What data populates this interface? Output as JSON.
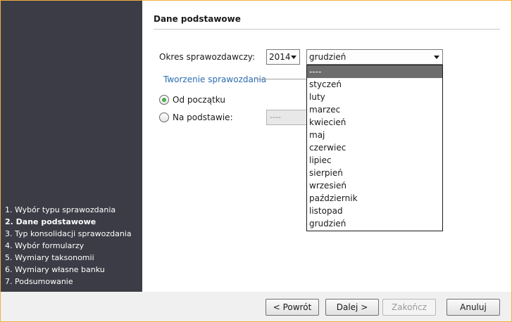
{
  "sidebar": {
    "steps": [
      {
        "label": "1. Wybór typu sprawozdania",
        "active": false
      },
      {
        "label": "2. Dane podstawowe",
        "active": true
      },
      {
        "label": "3. Typ konsolidacji sprawozdania",
        "active": false
      },
      {
        "label": "4. Wybór formularzy",
        "active": false
      },
      {
        "label": "5. Wymiary taksonomii",
        "active": false
      },
      {
        "label": "6. Wymiary własne banku",
        "active": false
      },
      {
        "label": "7. Podsumowanie",
        "active": false
      }
    ]
  },
  "main": {
    "section_title": "Dane podstawowe",
    "okres_label": "Okres sprawozdawczy:",
    "year_value": "2014",
    "month_value": "grudzień",
    "group_title": "Tworzenie sprawozdania",
    "radio_from_start": "Od początku",
    "radio_based_on": "Na podstawie:",
    "based_on_value": "----"
  },
  "dropdown": {
    "items": [
      "----",
      "styczeń",
      "luty",
      "marzec",
      "kwiecień",
      "maj",
      "czerwiec",
      "lipiec",
      "sierpień",
      "wrzesień",
      "październik",
      "listopad",
      "grudzień"
    ],
    "highlighted_index": 0
  },
  "footer": {
    "back_label": "< Powrót",
    "next_label": "Dalej >",
    "finish_label": "Zakończ",
    "cancel_label": "Anuluj"
  },
  "colors": {
    "sidebar_bg": "#3c3c46",
    "frame": "#f0b13c",
    "group_title": "#2b6cb0",
    "radio_checked": "#4caf50"
  }
}
